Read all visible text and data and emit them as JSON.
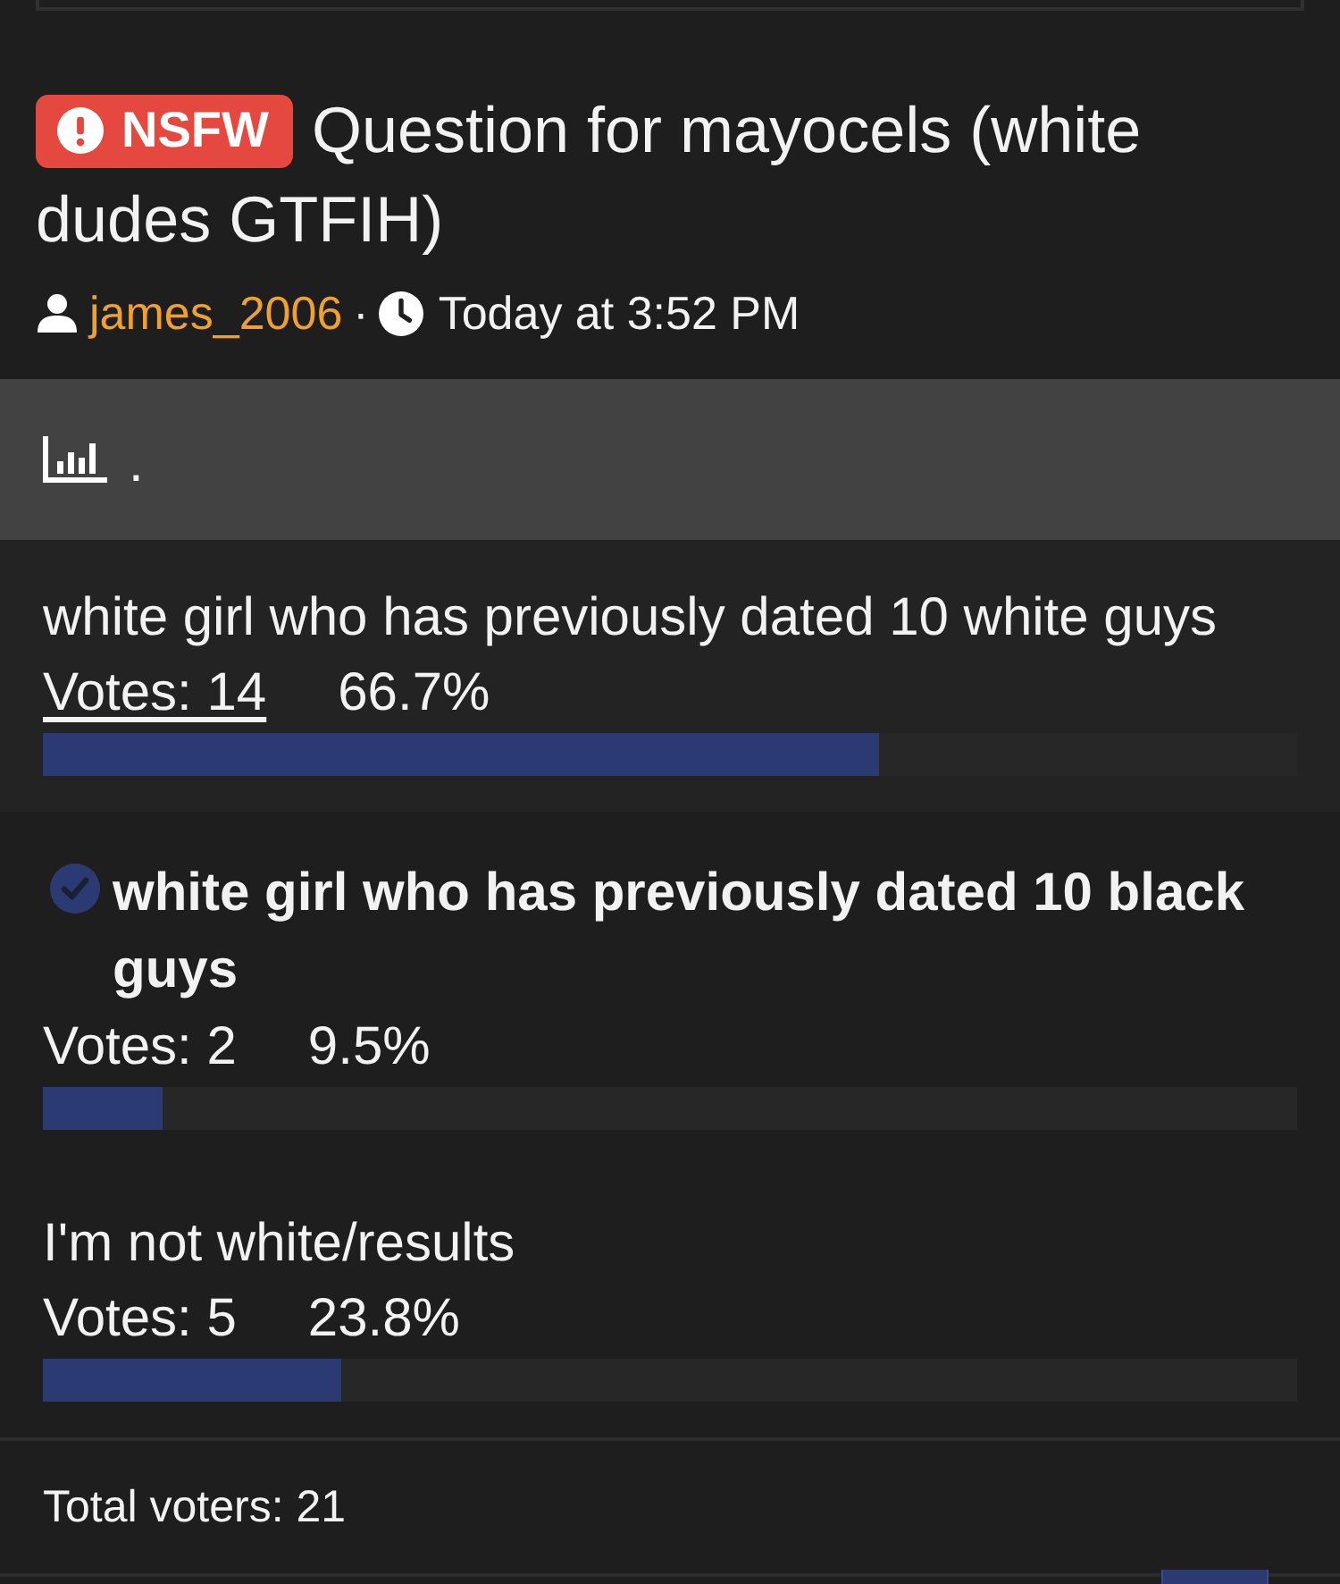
{
  "thread": {
    "badge": {
      "label": "NSFW"
    },
    "title": [
      "Question for mayocels (white",
      "dudes GTFIH)"
    ],
    "author": "james_2006",
    "separator": "·",
    "time": "Today at 3:52 PM"
  },
  "poll": {
    "title": ".",
    "options": [
      {
        "label": "white girl who has previously dated 10 white guys",
        "selected": false,
        "highlighted": true,
        "votes": "Votes: 14",
        "percent": "66.7%",
        "level": 0.667
      },
      {
        "label": "white girl who has previously dated 10 black guys",
        "selected": true,
        "highlighted": false,
        "votes": "Votes: 2",
        "percent": "9.5%",
        "level": 0.095
      },
      {
        "label": "I'm not white/results",
        "selected": false,
        "highlighted": false,
        "votes": "Votes: 5",
        "percent": "23.8%",
        "level": 0.238
      }
    ],
    "total_voters": "Total voters: 21"
  }
}
